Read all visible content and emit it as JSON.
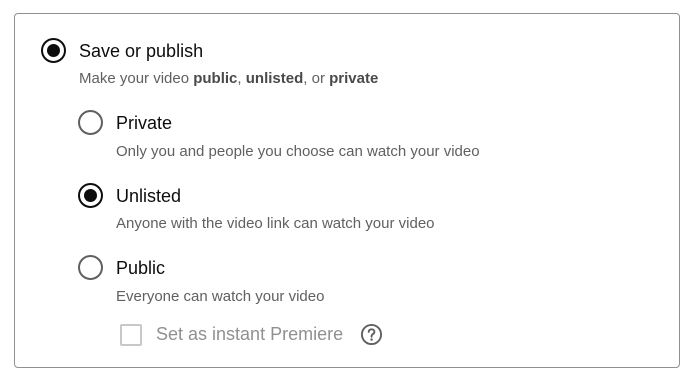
{
  "main_option": {
    "label": "Save or publish",
    "desc_prefix": "Make your video ",
    "desc_public": "public",
    "desc_sep1": ", ",
    "desc_unlisted": "unlisted",
    "desc_sep2": ", or ",
    "desc_private": "private",
    "selected": true
  },
  "visibility_options": [
    {
      "label": "Private",
      "description": "Only you and people you choose can watch your video",
      "selected": false
    },
    {
      "label": "Unlisted",
      "description": "Anyone with the video link can watch your video",
      "selected": true
    },
    {
      "label": "Public",
      "description": "Everyone can watch your video",
      "selected": false
    }
  ],
  "premiere": {
    "label": "Set as instant Premiere",
    "checked": false,
    "disabled": true,
    "help_icon": "help-circle-icon"
  },
  "colors": {
    "text_primary": "#0d0d0d",
    "text_secondary": "#606060",
    "border": "#909090"
  }
}
